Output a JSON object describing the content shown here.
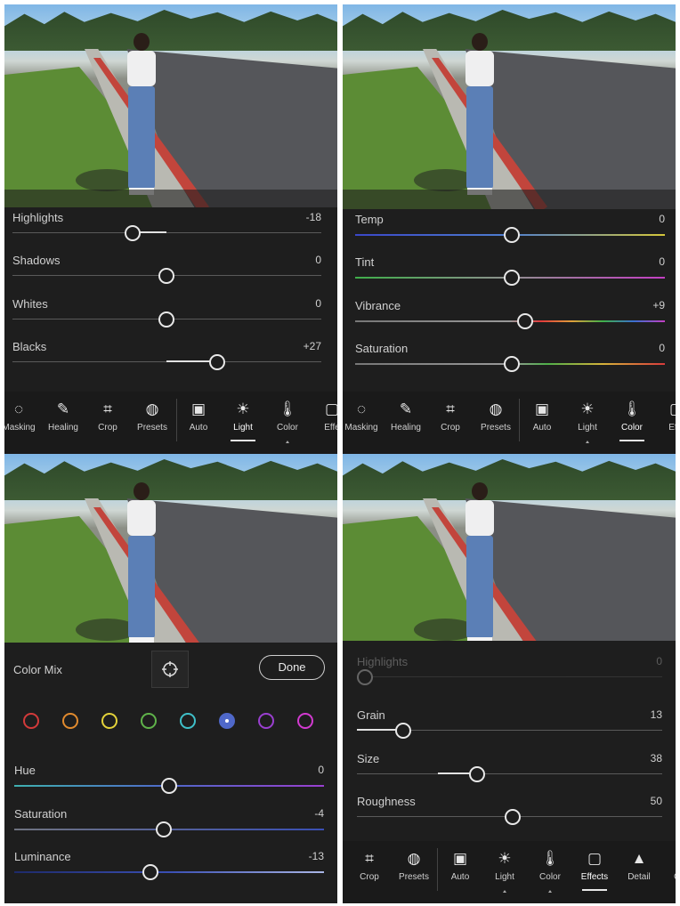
{
  "panel1": {
    "sliders": [
      {
        "label": "Highlights",
        "value": "-18",
        "pos": 0.4
      },
      {
        "label": "Shadows",
        "value": "0",
        "pos": 0.5
      },
      {
        "label": "Whites",
        "value": "0",
        "pos": 0.5
      },
      {
        "label": "Blacks",
        "value": "+27",
        "pos": 0.665
      }
    ],
    "toolbar": [
      {
        "label": "Masking",
        "icon": "masking-icon"
      },
      {
        "label": "Healing",
        "icon": "healing-icon"
      },
      {
        "label": "Crop",
        "icon": "crop-icon"
      },
      {
        "label": "Presets",
        "icon": "presets-icon"
      },
      {
        "label": "Auto",
        "icon": "auto-icon"
      },
      {
        "label": "Light",
        "icon": "light-icon"
      },
      {
        "label": "Color",
        "icon": "color-icon"
      },
      {
        "label": "Effe",
        "icon": "effects-icon"
      }
    ]
  },
  "panel2": {
    "sliders": [
      {
        "label": "Temp",
        "value": "0",
        "pos": 0.5
      },
      {
        "label": "Tint",
        "value": "0",
        "pos": 0.5
      },
      {
        "label": "Vibrance",
        "value": "+9",
        "pos": 0.545
      },
      {
        "label": "Saturation",
        "value": "0",
        "pos": 0.5
      }
    ],
    "toolbar": [
      {
        "label": "Masking",
        "icon": "masking-icon"
      },
      {
        "label": "Healing",
        "icon": "healing-icon"
      },
      {
        "label": "Crop",
        "icon": "crop-icon"
      },
      {
        "label": "Presets",
        "icon": "presets-icon"
      },
      {
        "label": "Auto",
        "icon": "auto-icon"
      },
      {
        "label": "Light",
        "icon": "light-icon"
      },
      {
        "label": "Color",
        "icon": "color-icon"
      },
      {
        "label": "Effe",
        "icon": "effects-icon"
      }
    ]
  },
  "panel3": {
    "title": "Color Mix",
    "done": "Done",
    "swatches": [
      "#d23a3a",
      "#e08a2e",
      "#e3d23a",
      "#5fb34a",
      "#3fc0c9",
      "#4f68c9",
      "#9a3fd0",
      "#d23ad0"
    ],
    "selected_swatch": 5,
    "sliders": [
      {
        "label": "Hue",
        "value": "0",
        "pos": 0.5
      },
      {
        "label": "Saturation",
        "value": "-4",
        "pos": 0.48
      },
      {
        "label": "Luminance",
        "value": "-13",
        "pos": 0.44
      }
    ]
  },
  "panel4": {
    "sliders": [
      {
        "label": "Highlights",
        "value": "0",
        "pos": 0.0
      },
      {
        "label": "Grain",
        "value": "13",
        "pos": 0.13
      },
      {
        "label": "Size",
        "value": "38",
        "pos": 0.38
      },
      {
        "label": "Roughness",
        "value": "50",
        "pos": 0.5
      }
    ],
    "toolbar": [
      {
        "label": "Crop",
        "icon": "crop-icon"
      },
      {
        "label": "Presets",
        "icon": "presets-icon"
      },
      {
        "label": "Auto",
        "icon": "auto-icon"
      },
      {
        "label": "Light",
        "icon": "light-icon"
      },
      {
        "label": "Color",
        "icon": "color-icon"
      },
      {
        "label": "Effects",
        "icon": "effects-icon"
      },
      {
        "label": "Detail",
        "icon": "detail-icon"
      },
      {
        "label": "O",
        "icon": "optics-icon"
      }
    ]
  }
}
